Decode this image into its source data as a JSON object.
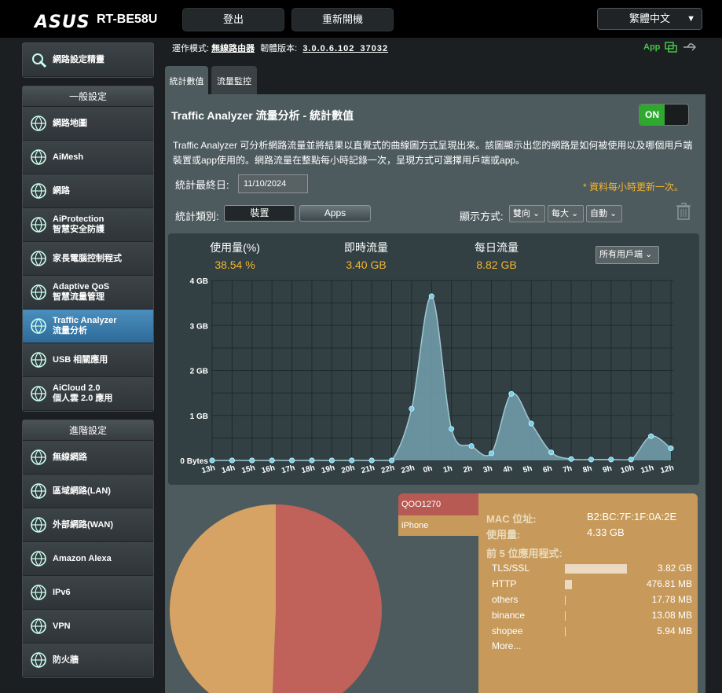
{
  "header": {
    "brand": "ASUS",
    "model": "RT-BE58U",
    "logout": "登出",
    "reboot": "重新開機",
    "language": "繁體中文"
  },
  "sidebar": {
    "top_item": "網路設定精靈",
    "general_title": "一般設定",
    "general_items": [
      {
        "l1": "網路地圖",
        "l2": "",
        "icon": "globe-network-icon"
      },
      {
        "l1": "AiMesh",
        "l2": "",
        "icon": "aimesh-icon"
      },
      {
        "l1": "網路",
        "l2": "",
        "icon": "network-globe-icon"
      },
      {
        "l1": "AiProtection",
        "l2": "智慧安全防護",
        "icon": "shield-lock-icon"
      },
      {
        "l1": "家長電腦控制程式",
        "l2": "",
        "icon": "parental-control-icon"
      },
      {
        "l1": "Adaptive QoS",
        "l2": "智慧流量管理",
        "icon": "speedometer-icon"
      },
      {
        "l1": "Traffic Analyzer",
        "l2": "流量分析",
        "icon": "traffic-wave-icon"
      },
      {
        "l1": "USB 相關應用",
        "l2": "",
        "icon": "usb-icon"
      },
      {
        "l1": "AiCloud 2.0",
        "l2": "個人雲 2.0 應用",
        "icon": "cloud-icon"
      }
    ],
    "advanced_title": "進階設定",
    "advanced_items": [
      {
        "l1": "無線網路",
        "l2": "",
        "icon": "wireless-icon"
      },
      {
        "l1": "區域網路(LAN)",
        "l2": "",
        "icon": "lan-icon"
      },
      {
        "l1": "外部網路(WAN)",
        "l2": "",
        "icon": "wan-globe-icon"
      },
      {
        "l1": "Amazon Alexa",
        "l2": "",
        "icon": "alexa-icon"
      },
      {
        "l1": "IPv6",
        "l2": "",
        "icon": "ipv6-icon"
      },
      {
        "l1": "VPN",
        "l2": "",
        "icon": "vpn-icon"
      },
      {
        "l1": "防火牆",
        "l2": "",
        "icon": "firewall-icon"
      }
    ]
  },
  "statusbar": {
    "mode_label": "運作模式:",
    "mode_value": "無線路由器",
    "fw_label": "韌體版本:",
    "fw_value": "3.0.0.6.102_37032",
    "app_label": "App"
  },
  "tabs": [
    "統計數值",
    "流量監控"
  ],
  "panel": {
    "title": "Traffic Analyzer 流量分析 - 統計數值",
    "toggle": "ON",
    "description": "Traffic Analyzer 可分析網路流量並將結果以直覺式的曲線圖方式呈現出來。該圖顯示出您的網路是如何被使用以及哪個用戶端裝置或app使用的。網路流量在整點每小時記錄一次，呈現方式可選擇用戶端或app。",
    "date_label": "統計最終日:",
    "date_value": "11/10/2024",
    "note": "* 資料每小時更新一次。",
    "type_label": "統計類別:",
    "type_device": "裝置",
    "type_apps": "Apps",
    "display_label": "顯示方式:",
    "display_opts": [
      "雙向",
      "每大",
      "自動"
    ],
    "stats": [
      {
        "label": "使用量(%)",
        "value": "38.54 %"
      },
      {
        "label": "即時流量",
        "value": "3.40 GB"
      },
      {
        "label": "每日流量",
        "value": "8.82 GB"
      }
    ],
    "client_select": "所有用戶端"
  },
  "chart_data": {
    "type": "area",
    "x": [
      "13h",
      "14h",
      "15h",
      "16h",
      "17h",
      "18h",
      "19h",
      "20h",
      "21h",
      "22h",
      "23h",
      "0h",
      "1h",
      "2h",
      "3h",
      "4h",
      "5h",
      "6h",
      "7h",
      "8h",
      "9h",
      "10h",
      "11h",
      "12h"
    ],
    "values": [
      0,
      0,
      0,
      0,
      0,
      0,
      0,
      0,
      0,
      0,
      1.15,
      3.65,
      0.7,
      0.32,
      0.16,
      1.48,
      0.82,
      0.18,
      0.03,
      0.02,
      0.02,
      0.02,
      0.54,
      0.27
    ],
    "yticks": [
      "0 Bytes",
      "1 GB",
      "2 GB",
      "3 GB",
      "4 GB"
    ],
    "ylim": [
      0,
      4
    ],
    "grid": true
  },
  "pie": {
    "slices": [
      {
        "name": "QOO1270",
        "value": 50.6,
        "color": "#c0615a"
      },
      {
        "name": "iPhone",
        "value": 49.4,
        "color": "#d7a364"
      }
    ]
  },
  "detail": {
    "mac_label": "MAC 位址:",
    "mac_value": "B2:BC:7F:1F:0A:2E",
    "usage_label": "使用量:",
    "usage_value": "4.33 GB",
    "top_label": "前 5 位應用程式:",
    "apps": [
      {
        "name": "TLS/SSL",
        "value": "3.82",
        "unit": "GB",
        "fraction": 1.0
      },
      {
        "name": "HTTP",
        "value": "476.81",
        "unit": "MB",
        "fraction": 0.12
      },
      {
        "name": "others",
        "value": "17.78",
        "unit": "MB",
        "fraction": 0.01
      },
      {
        "name": "binance",
        "value": "13.08",
        "unit": "MB",
        "fraction": 0.01
      },
      {
        "name": "shopee",
        "value": "5.94",
        "unit": "MB",
        "fraction": 0.01
      }
    ],
    "more": "More..."
  }
}
